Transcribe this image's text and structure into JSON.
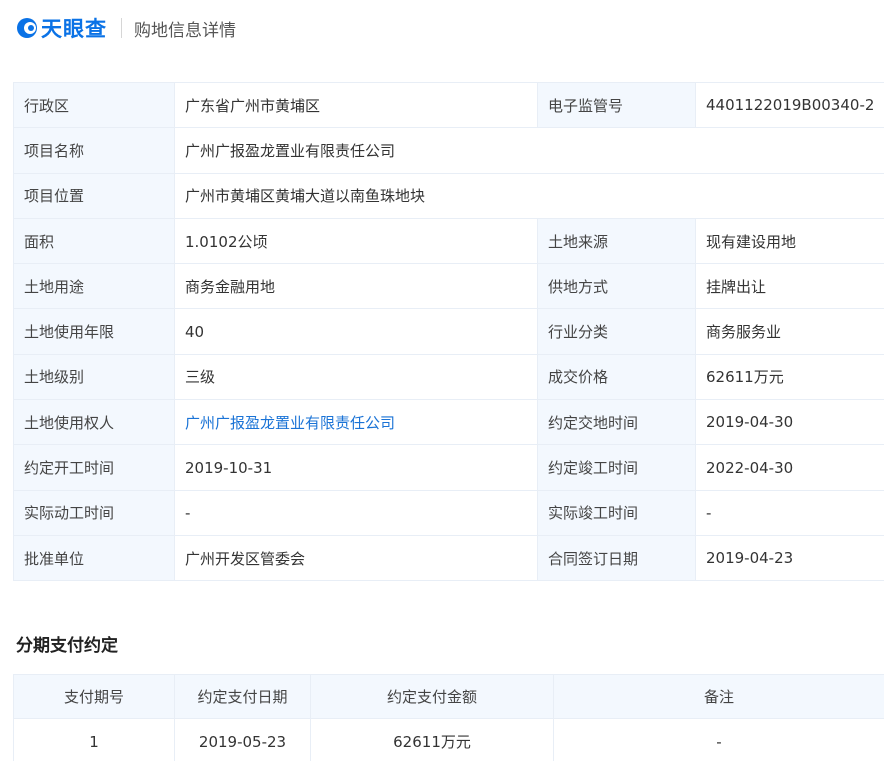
{
  "header": {
    "logo_text": "天眼查",
    "title": "购地信息详情"
  },
  "detail": {
    "rows": [
      {
        "label1": "行政区",
        "value1": "广东省广州市黄埔区",
        "label2": "电子监管号",
        "value2": "4401122019B00340-2"
      },
      {
        "label1": "项目名称",
        "value1": "广州广报盈龙置业有限责任公司"
      },
      {
        "label1": "项目位置",
        "value1": "广州市黄埔区黄埔大道以南鱼珠地块"
      },
      {
        "label1": "面积",
        "value1": "1.0102公顷",
        "label2": "土地来源",
        "value2": "现有建设用地"
      },
      {
        "label1": "土地用途",
        "value1": "商务金融用地",
        "label2": "供地方式",
        "value2": "挂牌出让"
      },
      {
        "label1": "土地使用年限",
        "value1": "40",
        "label2": "行业分类",
        "value2": "商务服务业"
      },
      {
        "label1": "土地级别",
        "value1": "三级",
        "label2": "成交价格",
        "value2": "62611万元"
      },
      {
        "label1": "土地使用权人",
        "value1": "广州广报盈龙置业有限责任公司",
        "label2": "约定交地时间",
        "value2": "2019-04-30"
      },
      {
        "label1": "约定开工时间",
        "value1": "2019-10-31",
        "label2": "约定竣工时间",
        "value2": "2022-04-30"
      },
      {
        "label1": "实际动工时间",
        "value1": "-",
        "label2": "实际竣工时间",
        "value2": "-"
      },
      {
        "label1": "批准单位",
        "value1": "广州开发区管委会",
        "label2": "合同签订日期",
        "value2": "2019-04-23"
      }
    ]
  },
  "payment": {
    "section_title": "分期支付约定",
    "columns": [
      "支付期号",
      "约定支付日期",
      "约定支付金额",
      "备注"
    ],
    "rows": [
      {
        "period": "1",
        "date": "2019-05-23",
        "amount": "62611万元",
        "remark": "-"
      }
    ]
  },
  "colors": {
    "brand": "#0a72e6",
    "link": "#1a73d6",
    "label_bg": "#f3f8fe",
    "border": "#e8eef6"
  }
}
